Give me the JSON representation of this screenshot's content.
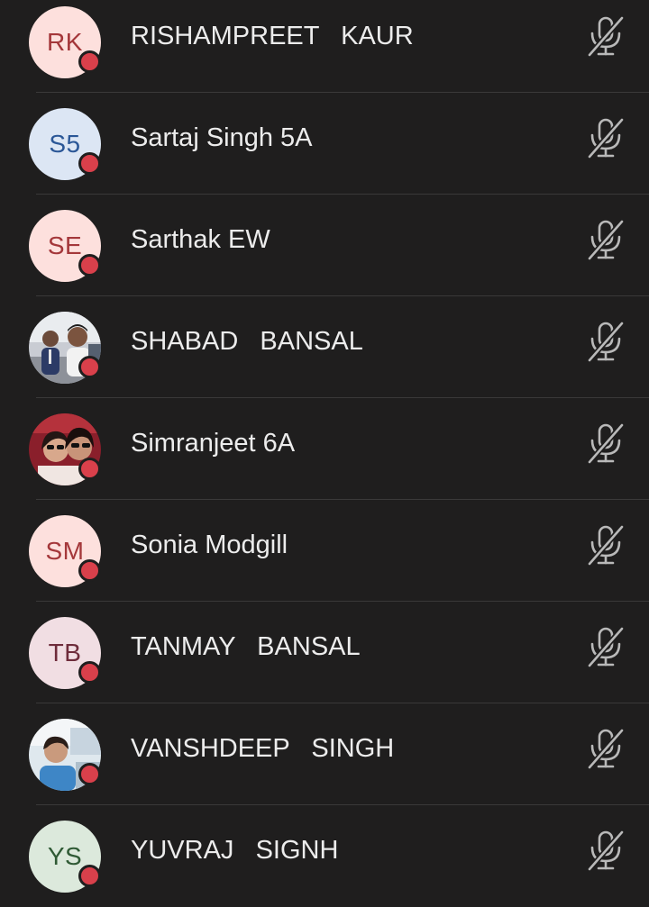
{
  "participants": [
    {
      "name": "RISHAMPREET   KAUR",
      "initials": "RK",
      "avatar_type": "initials",
      "avatar_bg": "#fde0dd",
      "avatar_fg": "#a4373a",
      "presence": "busy",
      "mic": "muted"
    },
    {
      "name": "Sartaj Singh 5A",
      "initials": "S5",
      "avatar_type": "initials",
      "avatar_bg": "#dce6f4",
      "avatar_fg": "#2b5797",
      "presence": "busy",
      "mic": "muted"
    },
    {
      "name": "Sarthak EW",
      "initials": "SE",
      "avatar_type": "initials",
      "avatar_bg": "#fde0dd",
      "avatar_fg": "#a4373a",
      "presence": "busy",
      "mic": "muted"
    },
    {
      "name": "SHABAD   BANSAL",
      "initials": "",
      "avatar_type": "photo",
      "presence": "busy",
      "mic": "muted"
    },
    {
      "name": "Simranjeet 6A",
      "initials": "",
      "avatar_type": "photo",
      "presence": "busy",
      "mic": "muted"
    },
    {
      "name": "Sonia Modgill",
      "initials": "SM",
      "avatar_type": "initials",
      "avatar_bg": "#fde0dd",
      "avatar_fg": "#a4373a",
      "presence": "busy",
      "mic": "muted"
    },
    {
      "name": "TANMAY   BANSAL",
      "initials": "TB",
      "avatar_type": "initials",
      "avatar_bg": "#f1dee3",
      "avatar_fg": "#6e2c3b",
      "presence": "busy",
      "mic": "muted"
    },
    {
      "name": "VANSHDEEP   SINGH",
      "initials": "",
      "avatar_type": "photo",
      "presence": "busy",
      "mic": "muted"
    },
    {
      "name": "YUVRAJ   SIGNH",
      "initials": "YS",
      "avatar_type": "initials",
      "avatar_bg": "#dce9dc",
      "avatar_fg": "#2f5a35",
      "presence": "busy",
      "mic": "muted"
    }
  ],
  "colors": {
    "background": "#1f1e1e",
    "divider": "#3a3939",
    "presence_busy": "#d9404b",
    "name_text": "#ececec",
    "mic_icon": "#b9b9b9"
  },
  "icons": {
    "mic_state": "mic-off-icon",
    "presence": "presence-busy-icon"
  }
}
